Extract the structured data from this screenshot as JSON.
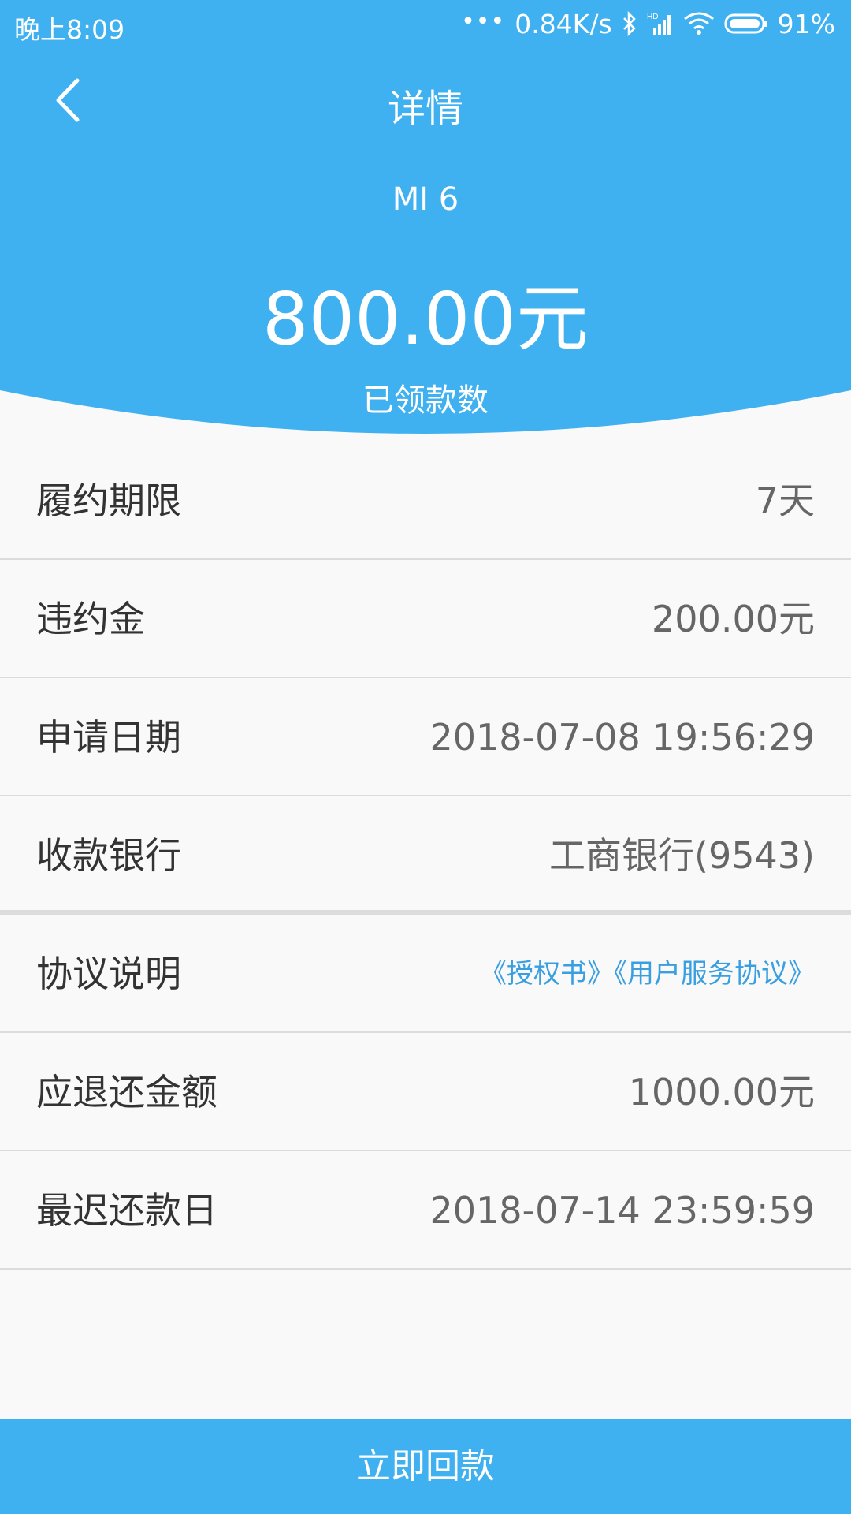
{
  "colors": {
    "primary": "#3fb0f0",
    "link": "#3a9fe0",
    "label_text": "#333333",
    "value_text": "#666666"
  },
  "status_bar": {
    "time": "晚上8:09",
    "network_speed": "0.84K/s",
    "battery_percent": "91%",
    "icons": [
      "bluetooth-icon",
      "signal-icon",
      "wifi-icon",
      "battery-icon"
    ]
  },
  "header": {
    "title": "详情",
    "back_icon": "chevron-left-icon"
  },
  "summary": {
    "device": "MI 6",
    "amount": "800.00元",
    "amount_label": "已领款数"
  },
  "details": [
    {
      "label": "履约期限",
      "value": "7天"
    },
    {
      "label": "违约金",
      "value": "200.00元"
    },
    {
      "label": "申请日期",
      "value": "2018-07-08 19:56:29"
    },
    {
      "label": "收款银行",
      "value": "工商银行(9543)"
    }
  ],
  "agreement": {
    "label": "协议说明",
    "link_authorization": "《授权书》",
    "link_service": "《用户服务协议》"
  },
  "repayment": [
    {
      "label": "应退还金额",
      "value": "1000.00元"
    },
    {
      "label": "最迟还款日",
      "value": "2018-07-14 23:59:59"
    }
  ],
  "action": {
    "label": "立即回款"
  }
}
